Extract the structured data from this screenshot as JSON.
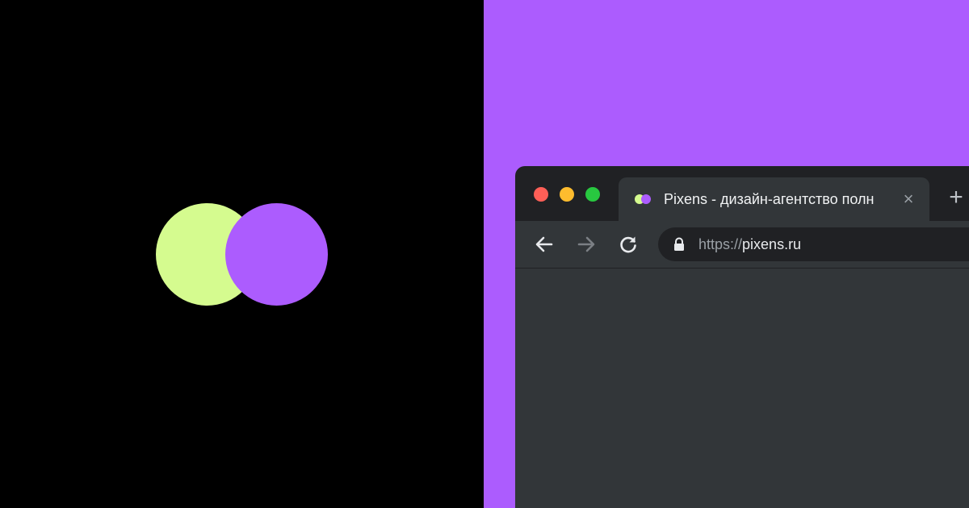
{
  "browser": {
    "tab": {
      "title": "Pixens - дизайн-агентство полн",
      "close_icon": "×"
    },
    "new_tab_icon": "+",
    "address_bar": {
      "scheme": "https://",
      "host": "pixens.ru"
    }
  },
  "colors": {
    "left_background": "#000000",
    "right_background": "#ac5cfe",
    "logo_lime": "#d5fb8f",
    "logo_purple": "#ac5cfe",
    "browser_frame": "#202124",
    "browser_toolbar": "#323639",
    "traffic_red": "#fe5f57",
    "traffic_yellow": "#febc2e",
    "traffic_green": "#28c840"
  },
  "icons": [
    "back-arrow-icon",
    "forward-arrow-icon",
    "reload-icon",
    "lock-icon",
    "close-icon",
    "plus-icon"
  ]
}
